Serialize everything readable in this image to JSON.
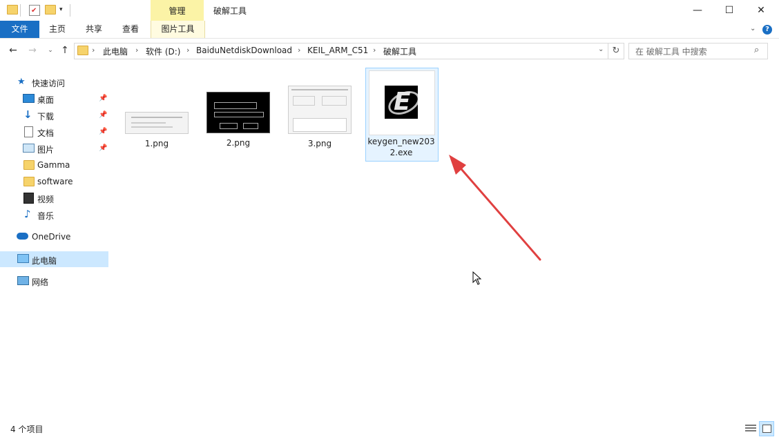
{
  "title_bar": {
    "manage_tab": "管理",
    "window_title": "破解工具",
    "minimize": "—",
    "maximize": "☐",
    "close": "✕"
  },
  "ribbon": {
    "tabs": [
      "文件",
      "主页",
      "共享",
      "查看",
      "图片工具"
    ]
  },
  "address": {
    "crumbs": [
      "此电脑",
      "软件 (D:)",
      "BaiduNetdiskDownload",
      "KEIL_ARM_C51",
      "破解工具"
    ],
    "search_placeholder": "在 破解工具 中搜索"
  },
  "sidebar": {
    "quick_access": "快速访问",
    "quick_items": [
      "桌面",
      "下载",
      "文档",
      "图片",
      "Gamma",
      "software",
      "视频",
      "音乐"
    ],
    "onedrive": "OneDrive",
    "this_pc": "此电脑",
    "network": "网络"
  },
  "files": [
    {
      "name": "1.png"
    },
    {
      "name": "2.png"
    },
    {
      "name": "3.png"
    },
    {
      "name": "keygen_new2032.exe"
    }
  ],
  "status": {
    "count": "4 个项目"
  },
  "colors": {
    "accent": "#1a6fc4",
    "manage_tab": "#fbf3a6",
    "selection": "#cce8ff",
    "arrow": "#e04040"
  }
}
